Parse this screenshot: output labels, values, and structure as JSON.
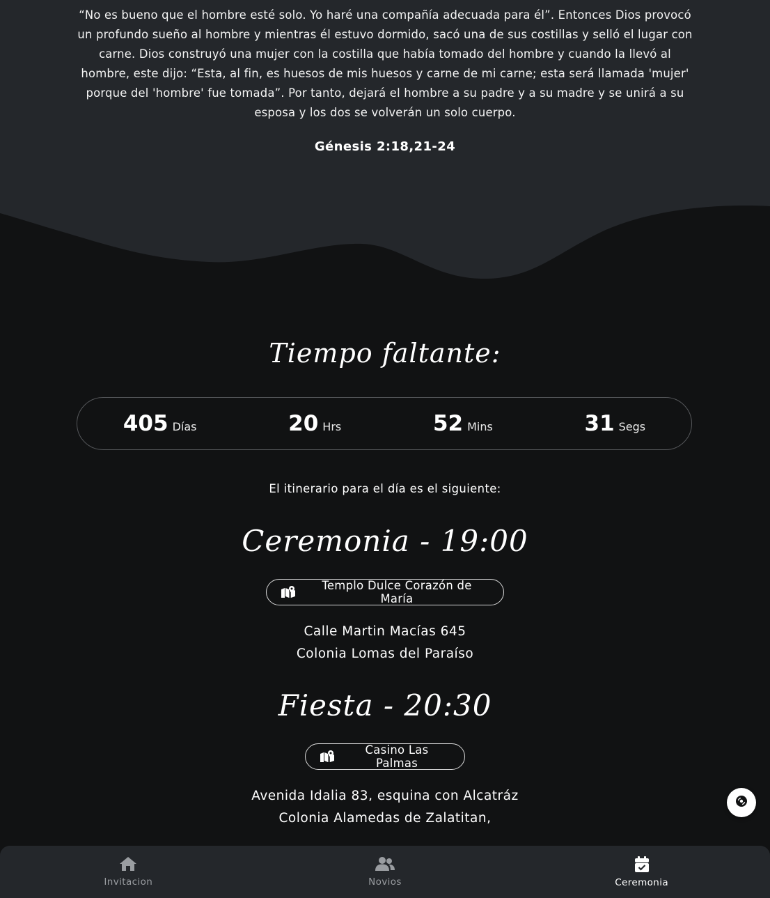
{
  "verse": {
    "text": "“No es bueno que el hombre esté solo. Yo haré una compañía adecuada para él”. Entonces Dios provocó un profundo sueño al hombre y mientras él estuvo dormido, sacó una de sus costillas y selló el lugar con carne. Dios construyó una mujer con la costilla que había tomado del hombre y cuando la llevó al hombre, este dijo: “Esta, al fin, es huesos de mis huesos y carne de mi carne; esta será llamada 'mujer' porque del 'hombre' fue tomada”. Por tanto, dejará el hombre a su padre y a su madre y se unirá a su esposa y los dos se volverán un solo cuerpo.",
    "reference": "Génesis 2:18,21-24"
  },
  "countdown": {
    "title": "Tiempo faltante:",
    "days": {
      "value": "405",
      "label": "Días"
    },
    "hours": {
      "value": "20",
      "label": "Hrs"
    },
    "minutes": {
      "value": "52",
      "label": "Mins"
    },
    "seconds": {
      "value": "31",
      "label": "Segs"
    }
  },
  "itinerary": {
    "intro": "El itinerario para el día es el siguiente:",
    "ceremony": {
      "title": "Ceremonia - 19:00",
      "venue": "Templo Dulce Corazón de María",
      "address_line1": "Calle Martin Macías 645",
      "address_line2": "Colonia Lomas del Paraíso"
    },
    "party": {
      "title": "Fiesta - 20:30",
      "venue": "Casino Las Palmas",
      "address_line1": "Avenida Idalia 83, esquina con Alcatráz",
      "address_line2": "Colonia Alamedas de Zalatitan,"
    }
  },
  "bottom_nav": {
    "items": [
      {
        "label": "Invitacion",
        "icon": "home-icon",
        "active": false
      },
      {
        "label": "Novios",
        "icon": "users-icon",
        "active": false
      },
      {
        "label": "Ceremonia",
        "icon": "calendar-check-icon",
        "active": true
      }
    ]
  },
  "music_button": {
    "icon": "music-disc-icon"
  },
  "colors": {
    "background": "#111213",
    "section_background": "#24272b",
    "text": "#ffffff",
    "nav_inactive": "#9a9da1"
  }
}
